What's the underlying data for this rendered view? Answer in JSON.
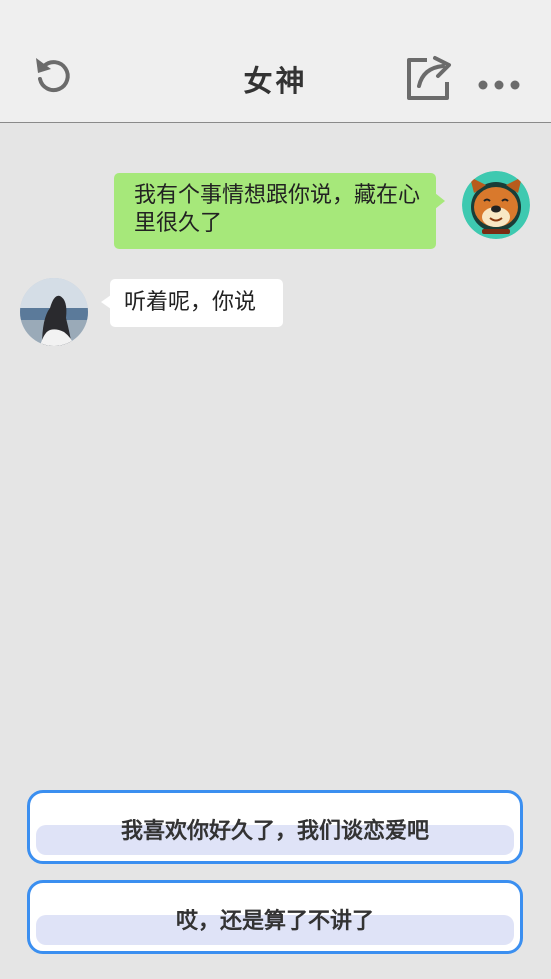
{
  "header": {
    "title": "女神",
    "icons": {
      "left": "refresh-icon",
      "share": "share-icon",
      "more": "more-icon"
    }
  },
  "chat": {
    "messages": [
      {
        "sender": "me",
        "text": "我有个事情想跟你说，藏在心里很久了",
        "avatar": "dog-avatar"
      },
      {
        "sender": "her",
        "text": "听着呢，你说",
        "avatar": "girl-avatar"
      }
    ]
  },
  "choices": [
    {
      "label": "我喜欢你好久了，我们谈恋爱吧"
    },
    {
      "label": "哎，还是算了不讲了"
    }
  ],
  "colors": {
    "my_bubble": "#a6e87a",
    "her_bubble": "#ffffff",
    "choice_border": "#3b8ff0",
    "background": "#e5e5e5"
  }
}
